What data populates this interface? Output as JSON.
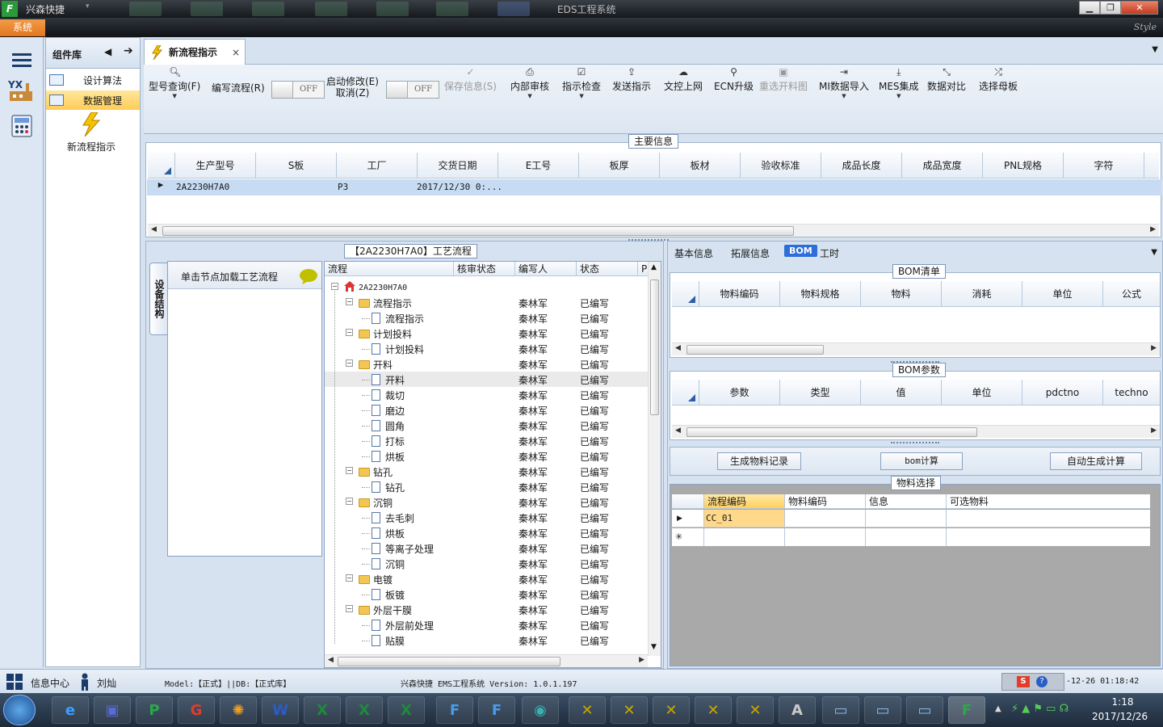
{
  "titlebar": {
    "app_name": "兴森快捷",
    "window_title": "EDS工程系统",
    "min": "▁",
    "max": "❐",
    "close": "✕"
  },
  "menu": {
    "system": "系统",
    "style": "Style"
  },
  "component_panel": {
    "title": "组件库",
    "items": [
      {
        "label": "设计算法"
      },
      {
        "label": "数据管理"
      }
    ],
    "new_process": "新流程指示"
  },
  "doc_tab": {
    "label": "新流程指示",
    "close": "×"
  },
  "ribbon": {
    "buttons": [
      {
        "label": "型号查询(F)"
      },
      {
        "label": "编写流程(R)"
      },
      {
        "label": "启动修改(E)",
        "label2": "取消(Z)"
      },
      {
        "label": "保存信息(S)"
      },
      {
        "label": "内部审核"
      },
      {
        "label": "指示检查"
      },
      {
        "label": "发送指示"
      },
      {
        "label": "文控上网"
      },
      {
        "label": "ECN升级"
      },
      {
        "label": "重选开料图"
      },
      {
        "label": "MI数据导入"
      },
      {
        "label": "MES集成"
      },
      {
        "label": "数据对比"
      },
      {
        "label": "选择母板"
      }
    ],
    "toggle_off": "OFF"
  },
  "main_info": {
    "title": "主要信息",
    "columns": [
      "生产型号",
      "S板",
      "工厂",
      "交货日期",
      "E工号",
      "板厚",
      "板材",
      "验收标准",
      "成品长度",
      "成品宽度",
      "PNL规格",
      "字符"
    ],
    "row": {
      "model": "2A2230H7A0",
      "factory": "P3",
      "date": "2017/12/30 0:..."
    }
  },
  "process": {
    "title": "【2A2230H7A0】工艺流程",
    "vtab": "设备结构",
    "node_hint": "单击节点加载工艺流程",
    "columns": [
      "流程",
      "核审状态",
      "编写人",
      "状态",
      "Pl"
    ],
    "root": "2A2230H7A0",
    "rows": [
      {
        "name": "流程指示",
        "type": "folder",
        "writer": "秦林军",
        "status": "已编写"
      },
      {
        "name": "流程指示",
        "type": "doc",
        "writer": "秦林军",
        "status": "已编写"
      },
      {
        "name": "计划投料",
        "type": "folder",
        "writer": "秦林军",
        "status": "已编写"
      },
      {
        "name": "计划投料",
        "type": "doc",
        "writer": "秦林军",
        "status": "已编写"
      },
      {
        "name": "开料",
        "type": "folder",
        "writer": "秦林军",
        "status": "已编写"
      },
      {
        "name": "开料",
        "type": "doc",
        "writer": "秦林军",
        "status": "已编写"
      },
      {
        "name": "裁切",
        "type": "doc",
        "writer": "秦林军",
        "status": "已编写"
      },
      {
        "name": "磨边",
        "type": "doc",
        "writer": "秦林军",
        "status": "已编写"
      },
      {
        "name": "圆角",
        "type": "doc",
        "writer": "秦林军",
        "status": "已编写"
      },
      {
        "name": "打标",
        "type": "doc",
        "writer": "秦林军",
        "status": "已编写"
      },
      {
        "name": "烘板",
        "type": "doc",
        "writer": "秦林军",
        "status": "已编写"
      },
      {
        "name": "钻孔",
        "type": "folder",
        "writer": "秦林军",
        "status": "已编写"
      },
      {
        "name": "钻孔",
        "type": "doc",
        "writer": "秦林军",
        "status": "已编写"
      },
      {
        "name": "沉铜",
        "type": "folder",
        "writer": "秦林军",
        "status": "已编写"
      },
      {
        "name": "去毛刺",
        "type": "doc",
        "writer": "秦林军",
        "status": "已编写"
      },
      {
        "name": "烘板",
        "type": "doc",
        "writer": "秦林军",
        "status": "已编写"
      },
      {
        "name": "等离子处理",
        "type": "doc",
        "writer": "秦林军",
        "status": "已编写"
      },
      {
        "name": "沉铜",
        "type": "doc",
        "writer": "秦林军",
        "status": "已编写"
      },
      {
        "name": "电镀",
        "type": "folder",
        "writer": "秦林军",
        "status": "已编写"
      },
      {
        "name": "板镀",
        "type": "doc",
        "writer": "秦林军",
        "status": "已编写"
      },
      {
        "name": "外层干膜",
        "type": "folder",
        "writer": "秦林军",
        "status": "已编写"
      },
      {
        "name": "外层前处理",
        "type": "doc",
        "writer": "秦林军",
        "status": "已编写"
      },
      {
        "name": "贴膜",
        "type": "doc",
        "writer": "秦林军",
        "status": "已编写"
      }
    ]
  },
  "right_tabs": [
    "基本信息",
    "拓展信息",
    "BOM",
    "工时"
  ],
  "bom_list": {
    "title": "BOM清单",
    "columns": [
      "物料编码",
      "物料规格",
      "物料",
      "消耗",
      "单位",
      "公式"
    ]
  },
  "bom_params": {
    "title": "BOM参数",
    "columns": [
      "参数",
      "类型",
      "值",
      "单位",
      "pdctno",
      "techno"
    ]
  },
  "bom_buttons": {
    "gen": "生成物料记录",
    "calc": "bom计算",
    "auto": "自动生成计算"
  },
  "material": {
    "title": "物料选择",
    "columns": [
      "流程编码",
      "物料编码",
      "信息",
      "可选物料"
    ],
    "row1": "CC_01",
    "new_row": "✳",
    "cur_row": "▶"
  },
  "statusbar": {
    "info": "信息中心",
    "user": "刘灿",
    "model": "Model:【正式】||DB:【正式库】",
    "version": "兴森快捷 EMS工程系统 Version: 1.0.1.197",
    "datetime": "-12-26 01:18:42"
  },
  "taskbar": {
    "time": "1:18",
    "date": "2017/12/26"
  }
}
